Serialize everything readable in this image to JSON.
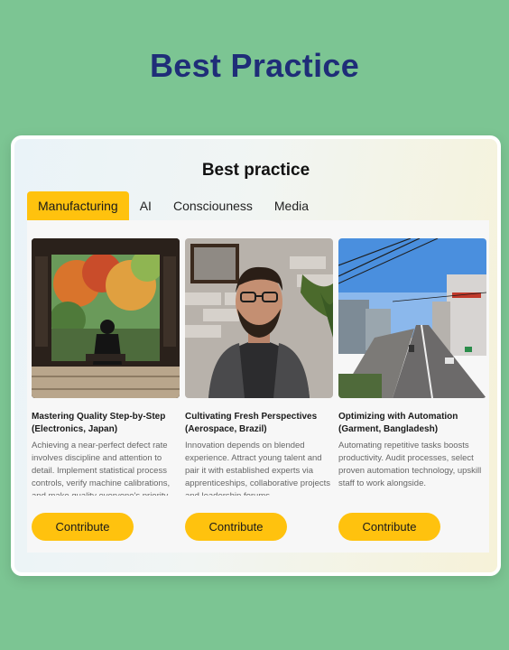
{
  "page": {
    "title": "Best Practice"
  },
  "card": {
    "title": "Best practice"
  },
  "tabs": [
    {
      "label": "Manufacturing",
      "active": true
    },
    {
      "label": "AI",
      "active": false
    },
    {
      "label": "Consciouness",
      "active": false
    },
    {
      "label": "Media",
      "active": false
    }
  ],
  "items": [
    {
      "title": "Mastering Quality Step-by-Step (Electronics, Japan)",
      "description": "Achieving a near-perfect defect rate involves discipline and attention to detail. Implement statistical process controls, verify machine calibrations, and make quality everyone's priority.",
      "button": "Contribute"
    },
    {
      "title": "Cultivating Fresh Perspectives (Aerospace, Brazil)",
      "description": "Innovation depends on blended experience. Attract young talent and pair it with established experts via apprenticeships, collaborative projects and leadership forums",
      "button": "Contribute"
    },
    {
      "title": "Optimizing with Automation (Garment, Bangladesh)",
      "description": "Automating repetitive tasks boosts productivity. Audit processes, select proven automation technology, upskill staff to work alongside.",
      "button": "Contribute"
    }
  ],
  "colors": {
    "background": "#7cc593",
    "title": "#1f2d78",
    "accent": "#ffc20e"
  }
}
